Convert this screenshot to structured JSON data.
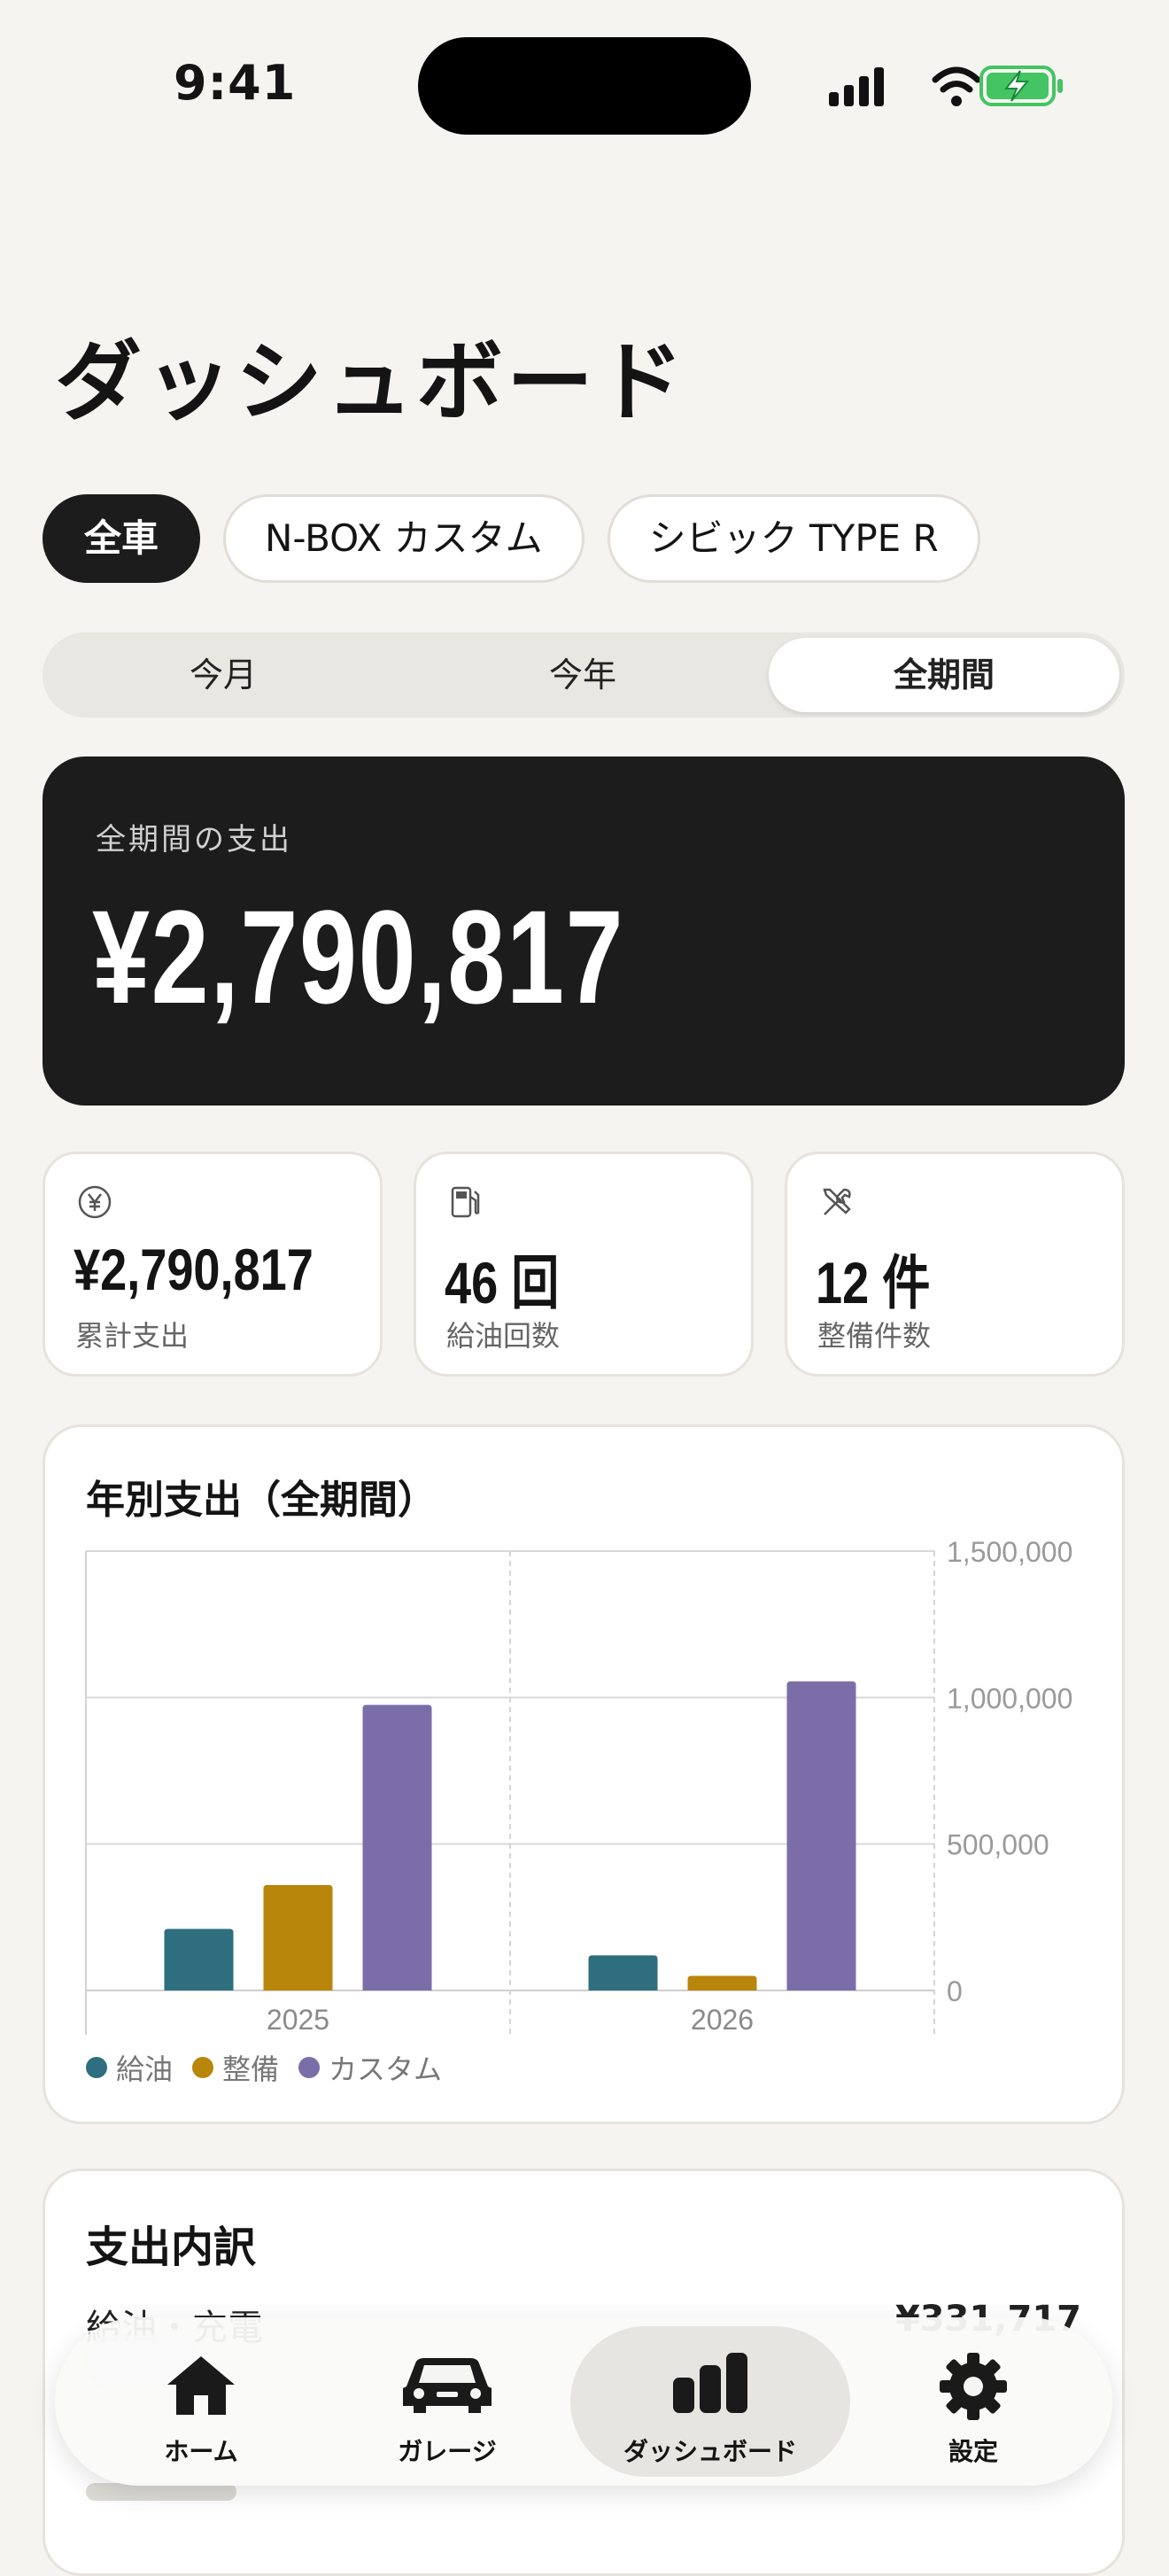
{
  "status_bar": {
    "time": "9:41"
  },
  "page": {
    "title": "ダッシュボード"
  },
  "vehicle_chips": [
    {
      "label": "全車",
      "active": true
    },
    {
      "label": "N-BOX カスタム",
      "active": false
    },
    {
      "label": "シビック TYPE R",
      "active": false
    }
  ],
  "period_segments": [
    {
      "label": "今月",
      "active": false
    },
    {
      "label": "今年",
      "active": false
    },
    {
      "label": "全期間",
      "active": true
    }
  ],
  "hero": {
    "label": "全期間の支出",
    "value": "¥2,790,817"
  },
  "stats": [
    {
      "icon": "yen-icon",
      "value": "¥2,790,817",
      "label": "累計支出"
    },
    {
      "icon": "fuel-pump-icon",
      "value": "46 回",
      "label": "給油回数"
    },
    {
      "icon": "tools-icon",
      "value": "12 件",
      "label": "整備件数"
    }
  ],
  "chart_card": {
    "title": "年別支出（全期間）"
  },
  "chart_data": {
    "type": "bar",
    "title": "年別支出（全期間）",
    "categories": [
      "2025",
      "2026"
    ],
    "series": [
      {
        "name": "給油",
        "color": "#2e6e7e",
        "values": [
          210000,
          120000
        ]
      },
      {
        "name": "整備",
        "color": "#b8860b",
        "values": [
          360000,
          50000
        ]
      },
      {
        "name": "カスタム",
        "color": "#7b6ea8",
        "values": [
          975000,
          1055000
        ]
      }
    ],
    "ylim": [
      0,
      1500000
    ],
    "y_ticks": [
      "0",
      "500,000",
      "1,000,000",
      "1,500,000"
    ],
    "y_tick_values": [
      0,
      500000,
      1000000,
      1500000
    ],
    "grid": true,
    "legend_position": "bottom-left"
  },
  "breakdown": {
    "title": "支出内訳",
    "row_label": "給油・充電",
    "row_value": "¥331,717"
  },
  "tabbar": [
    {
      "label": "ホーム",
      "icon": "home-icon",
      "active": false
    },
    {
      "label": "ガレージ",
      "icon": "car-icon",
      "active": false
    },
    {
      "label": "ダッシュボード",
      "icon": "bar-chart-icon",
      "active": true
    },
    {
      "label": "設定",
      "icon": "gear-icon",
      "active": false
    }
  ]
}
